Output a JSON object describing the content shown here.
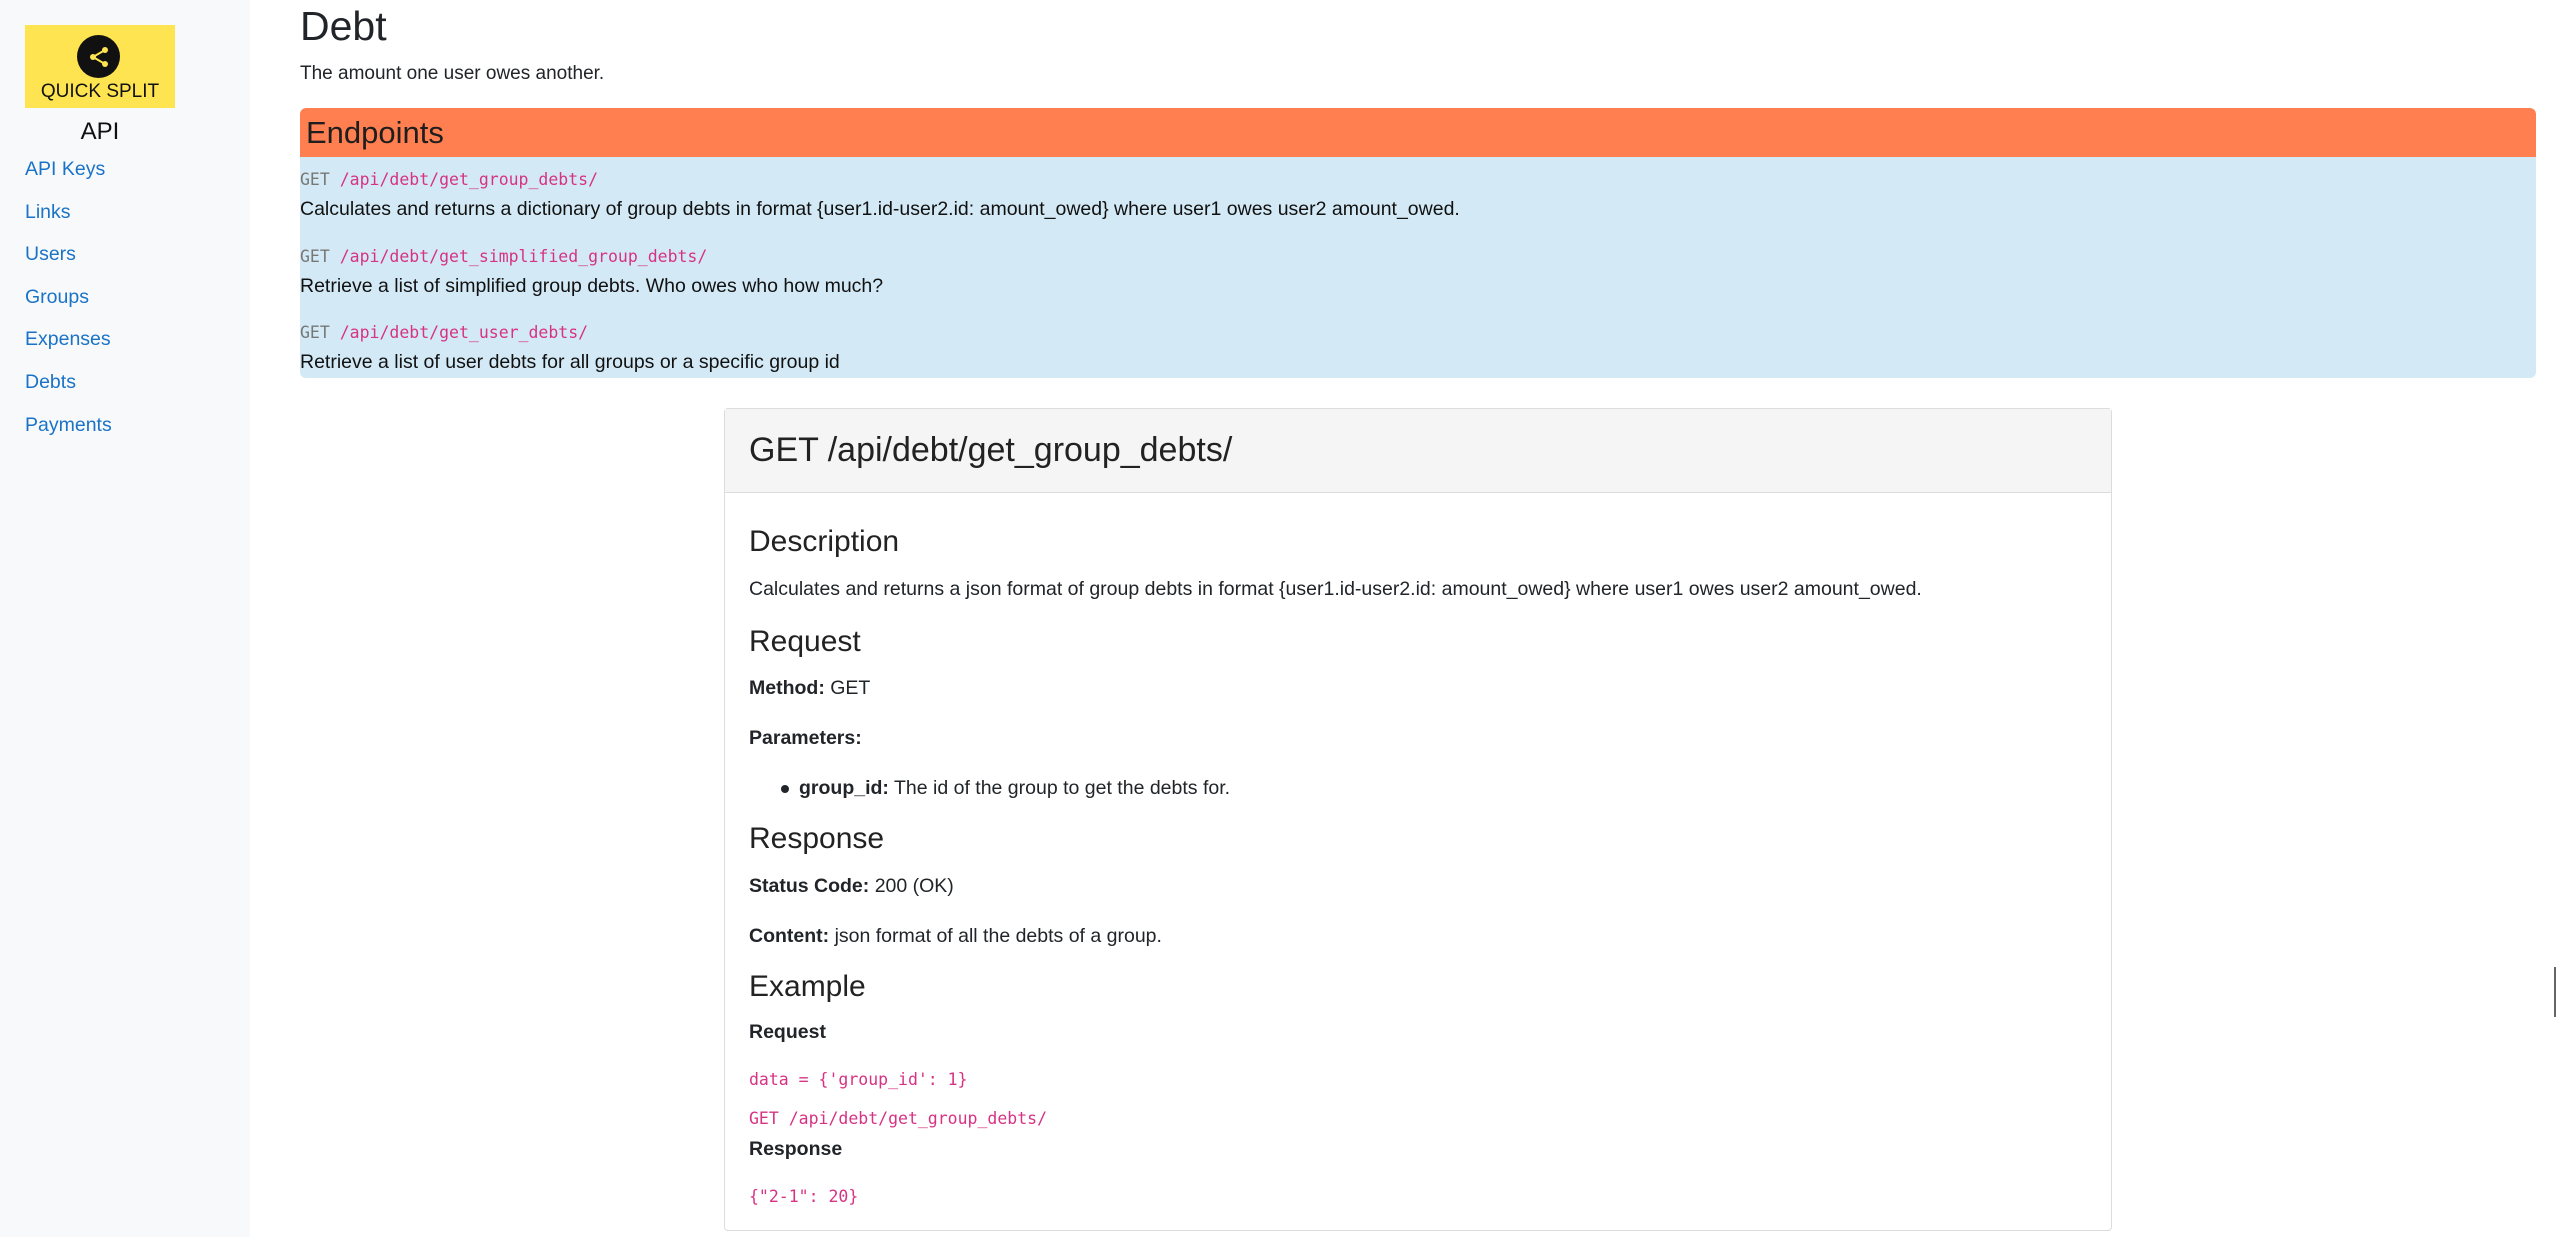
{
  "brand": {
    "logo_text": "QUICK SPLIT",
    "icon": "share-icon"
  },
  "sidebar": {
    "heading": "API",
    "items": [
      {
        "label": "API Keys"
      },
      {
        "label": "Links"
      },
      {
        "label": "Users"
      },
      {
        "label": "Groups"
      },
      {
        "label": "Expenses"
      },
      {
        "label": "Debts"
      },
      {
        "label": "Payments"
      }
    ]
  },
  "page": {
    "title": "Debt",
    "subtitle": "The amount one user owes another."
  },
  "endpoints": {
    "header": "Endpoints",
    "items": [
      {
        "method": "GET",
        "path": "/api/debt/get_group_debts/",
        "description": "Calculates and returns a dictionary of group debts in format {user1.id-user2.id: amount_owed} where user1 owes user2 amount_owed."
      },
      {
        "method": "GET",
        "path": "/api/debt/get_simplified_group_debts/",
        "description": "Retrieve a list of simplified group debts. Who owes who how much?"
      },
      {
        "method": "GET",
        "path": "/api/debt/get_user_debts/",
        "description": "Retrieve a list of user debts for all groups or a specific group id"
      }
    ]
  },
  "detail": {
    "title": "GET /api/debt/get_group_debts/",
    "description_heading": "Description",
    "description": "Calculates and returns a json format of group debts in format {user1.id-user2.id: amount_owed} where user1 owes user2 amount_owed.",
    "request_heading": "Request",
    "method_label": "Method:",
    "method_value": "GET",
    "parameters_label": "Parameters:",
    "param_name": "group_id:",
    "param_desc": "The id of the group to get the debts for.",
    "response_heading": "Response",
    "status_label": "Status Code:",
    "status_value": "200 (OK)",
    "content_label": "Content:",
    "content_value": "json format of all the debts of a group.",
    "example_heading": "Example",
    "example_request_label": "Request",
    "example_request_data": "data = {'group_id': 1}",
    "example_request_call": "GET /api/debt/get_group_debts/",
    "example_response_label": "Response",
    "example_response_body": "{\"2-1\": 20}"
  },
  "colors": {
    "endpoints_header": "#ff7f50",
    "endpoints_bg": "#d3eaf6",
    "logo_bg": "#fee450",
    "link": "#1a73c7",
    "code": "#d63384"
  }
}
